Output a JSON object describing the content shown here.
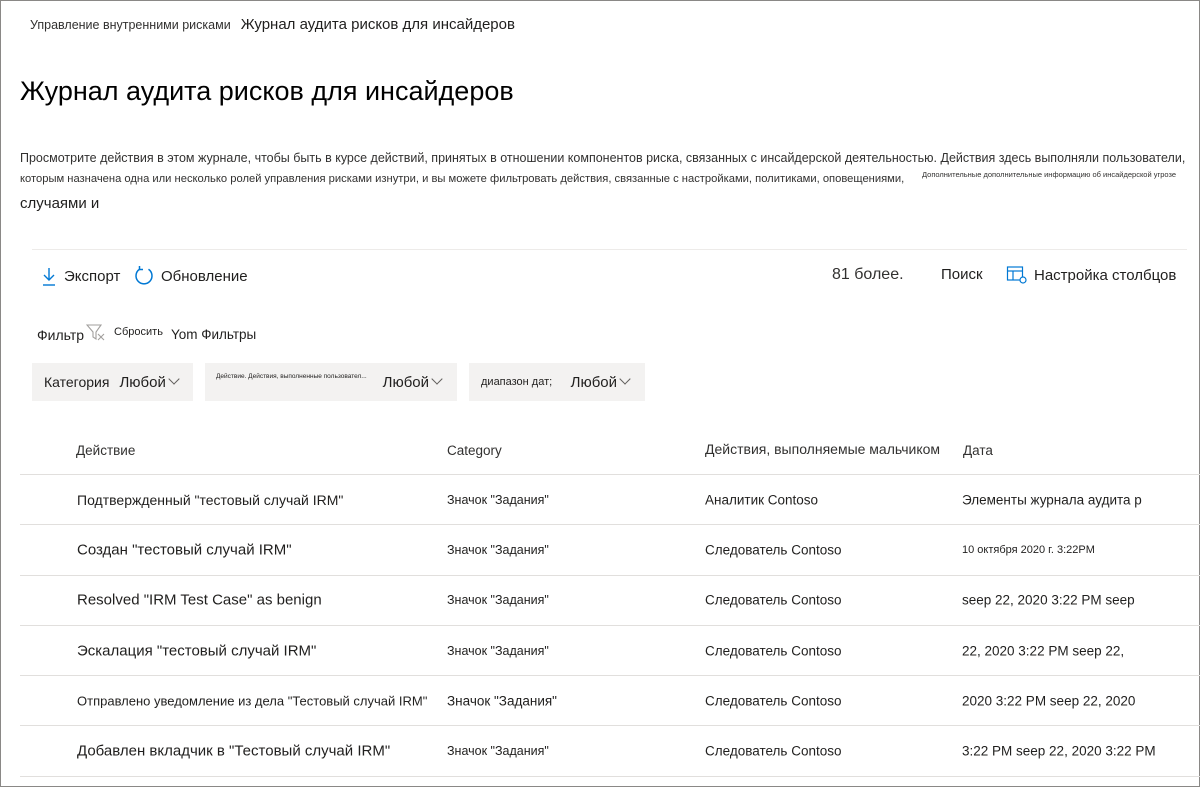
{
  "breadcrumb": {
    "parent": "Управление внутренними рисками",
    "current": "Журнал аудита рисков для инсайдеров"
  },
  "page_title": "Журнал аудита рисков для инсайдеров",
  "description": {
    "line1": "Просмотрите действия в этом журнале, чтобы быть в курсе действий, принятых в отношении компонентов риска, связанных с инсайдерской деятельностью. Действия здесь выполняли пользователи,",
    "line2": "которым назначена одна или несколько ролей управления рисками изнутри, и вы можете фильтровать действия, связанные с настройками, политиками, оповещениями,",
    "link": "Дополнительные дополнительные информацию об инсайдерской угрозе",
    "line3": "случаями и"
  },
  "toolbar": {
    "export_label": "Экспорт",
    "refresh_label": "Обновление",
    "count_text": "81 более.",
    "search_label": "Поиск",
    "customize_label": "Настройка столбцов"
  },
  "filter_bar": {
    "filter_label": "Фильтр",
    "reset_label": "Сбросить",
    "filters_label": "Yom Фильтры"
  },
  "chips": [
    {
      "label": "Категория",
      "value": "Любой"
    },
    {
      "label": "Действие. Действия, выполненные пользовател...",
      "value": "Любой"
    },
    {
      "label": "диапазон дат;",
      "value": "Любой"
    }
  ],
  "table": {
    "columns": [
      "Действие",
      "Category",
      "Действия, выполняемые мальчиком",
      "Дата"
    ],
    "rows": [
      {
        "action": "Подтвержденный \"тестовый случай IRM\"",
        "category": "Значок \"Задания\"",
        "performed_by": "Аналитик Contoso",
        "date": "Элементы журнала аудита р"
      },
      {
        "action": "Создан \"тестовый случай IRM\"",
        "category": "Значок \"Задания\"",
        "performed_by": "Следователь Contoso",
        "date": "10 октября 2020 г. 3:22PM"
      },
      {
        "action": "Resolved \"IRM Test Case\" as benign",
        "category": "Значок \"Задания\"",
        "performed_by": "Следователь Contoso",
        "date": "seep 22, 2020 3:22 PM seep"
      },
      {
        "action": "Эскалация \"тестовый случай IRM\"",
        "category": "Значок \"Задания\"",
        "performed_by": "Следователь Contoso",
        "date": "22, 2020 3:22 PM seep 22,"
      },
      {
        "action": "Отправлено уведомление из дела \"Тестовый случай IRM\"",
        "category": "Значок \"Задания\"",
        "performed_by": "Следователь Contoso",
        "date": "2020 3:22 PM seep 22, 2020"
      },
      {
        "action": "Добавлен вкладчик в \"Тестовый случай IRM\"",
        "category": "Значок \"Задания\"",
        "performed_by": "Следователь Contoso",
        "date": "3:22 PM seep 22, 2020 3:22 PM"
      }
    ]
  },
  "colors": {
    "accent": "#0078d4",
    "chip_background": "#f3f2f1",
    "divider": "#e1dfdd",
    "text": "#201f1e"
  },
  "icons": {
    "export": "download-arrow-icon",
    "refresh": "refresh-icon",
    "columns": "customize-columns-icon",
    "filter": "filter-clear-icon",
    "chevron": "chevron-down-icon"
  }
}
